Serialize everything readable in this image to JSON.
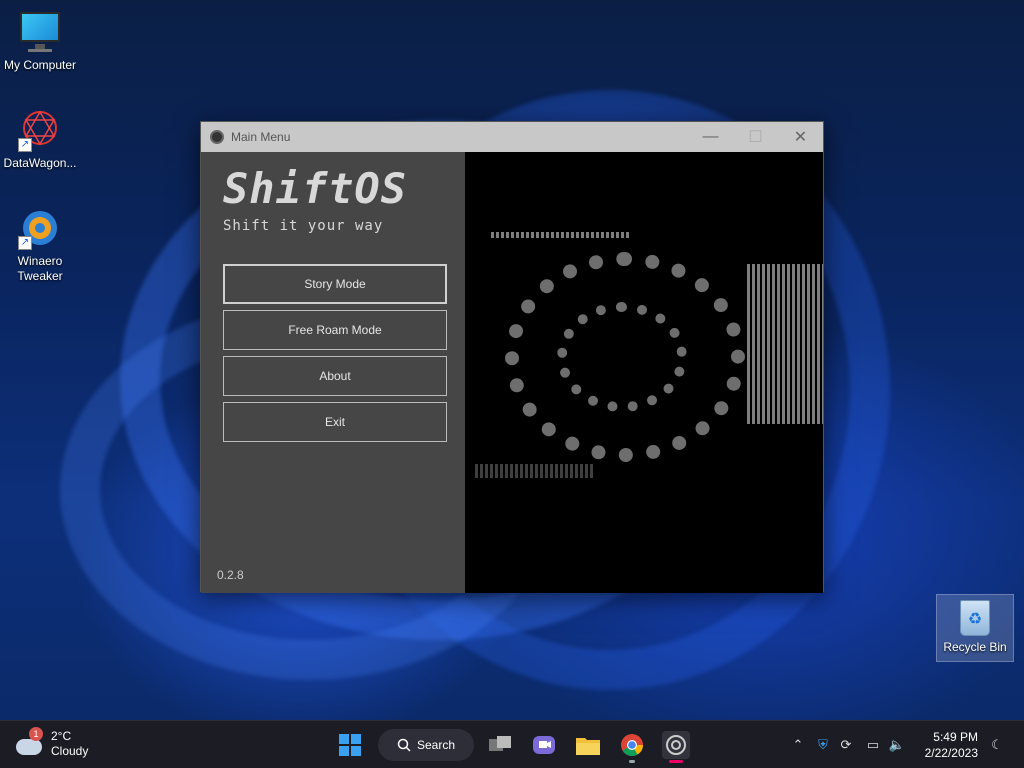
{
  "desktop": {
    "icons": [
      {
        "label": "My Computer",
        "icon": "monitor-icon"
      },
      {
        "label": "DataWagon...",
        "icon": "datawagon-icon"
      },
      {
        "label": "Winaero Tweaker",
        "icon": "winaero-icon"
      }
    ],
    "recycle_bin": {
      "label": "Recycle Bin",
      "icon": "recycle-bin-icon"
    }
  },
  "window": {
    "title": "Main Menu",
    "controls": {
      "minimize": "—",
      "maximize": "☐",
      "close": "✕"
    },
    "brand": "ShiftOS",
    "tagline": "Shift it your way",
    "buttons": [
      {
        "label": "Story Mode"
      },
      {
        "label": "Free Roam Mode"
      },
      {
        "label": "About"
      },
      {
        "label": "Exit"
      }
    ],
    "version": "0.2.8"
  },
  "taskbar": {
    "weather": {
      "temp": "2°C",
      "condition": "Cloudy",
      "badge": "1"
    },
    "search_label": "Search",
    "clock": {
      "time": "5:49 PM",
      "date": "2/22/2023"
    }
  },
  "colors": {
    "titlebar": "#c8c8c8",
    "panel": "#464646",
    "art_bg": "#000000",
    "taskbar": "#1c1c24",
    "windows_accent": "#3aa0f0"
  }
}
